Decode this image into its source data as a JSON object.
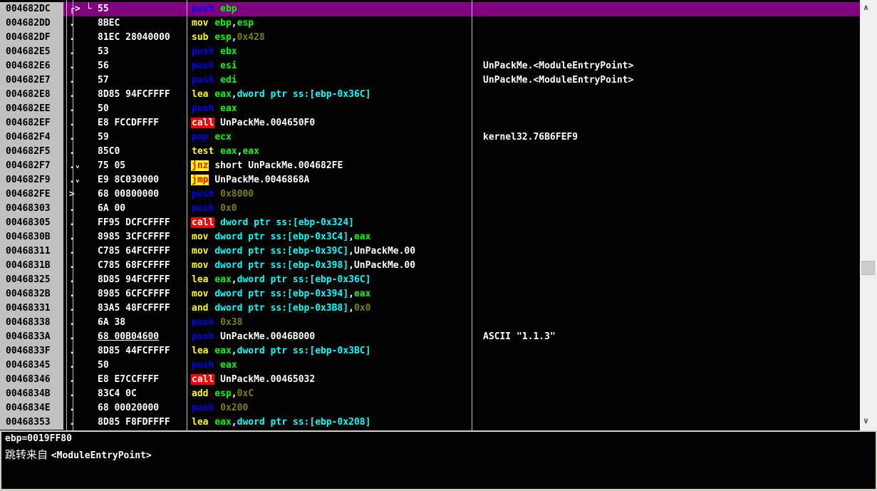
{
  "disasm": {
    "rows": [
      {
        "addr": "004682DC",
        "arrow": "┌> └",
        "bytes": "55",
        "mn": "push",
        "ops": [
          [
            "ebp",
            "reg"
          ]
        ],
        "cmt": "",
        "sel": true
      },
      {
        "addr": "004682DD",
        "arrow": ".",
        "bytes": "8BEC",
        "mn": "mov",
        "ops": [
          [
            "ebp",
            "reg"
          ],
          [
            ",",
            "lbl"
          ],
          [
            "esp",
            "reg"
          ]
        ],
        "cmt": ""
      },
      {
        "addr": "004682DF",
        "arrow": ".",
        "bytes": "81EC 28040000",
        "mn": "sub",
        "ops": [
          [
            "esp",
            "reg"
          ],
          [
            ",",
            "lbl"
          ],
          [
            "0x428",
            "imm"
          ]
        ],
        "cmt": ""
      },
      {
        "addr": "004682E5",
        "arrow": ".",
        "bytes": "53",
        "mn": "push",
        "ops": [
          [
            "ebx",
            "reg"
          ]
        ],
        "cmt": ""
      },
      {
        "addr": "004682E6",
        "arrow": ".",
        "bytes": "56",
        "mn": "push",
        "ops": [
          [
            "esi",
            "reg"
          ]
        ],
        "cmt": "UnPackMe.<ModuleEntryPoint>"
      },
      {
        "addr": "004682E7",
        "arrow": ".",
        "bytes": "57",
        "mn": "push",
        "ops": [
          [
            "edi",
            "reg"
          ]
        ],
        "cmt": "UnPackMe.<ModuleEntryPoint>"
      },
      {
        "addr": "004682E8",
        "arrow": ".",
        "bytes": "8D85 94FCFFFF",
        "mn": "lea",
        "ops": [
          [
            "eax",
            "reg"
          ],
          [
            ",",
            "lbl"
          ],
          [
            "dword ptr ss:[ebp-0x36C]",
            "mem"
          ]
        ],
        "cmt": ""
      },
      {
        "addr": "004682EE",
        "arrow": ".",
        "bytes": "50",
        "mn": "push",
        "ops": [
          [
            "eax",
            "reg"
          ]
        ],
        "cmt": ""
      },
      {
        "addr": "004682EF",
        "arrow": ".",
        "bytes": "E8 FCCDFFFF",
        "mn": "call",
        "ops": [
          [
            "UnPackMe.004650F0",
            "lbl"
          ]
        ],
        "cmt": ""
      },
      {
        "addr": "004682F4",
        "arrow": ".",
        "bytes": "59",
        "mn": "pop",
        "ops": [
          [
            "ecx",
            "reg"
          ]
        ],
        "cmt": "kernel32.76B6FEF9"
      },
      {
        "addr": "004682F5",
        "arrow": ".",
        "bytes": "85C0",
        "mn": "test",
        "ops": [
          [
            "eax",
            "reg"
          ],
          [
            ",",
            "lbl"
          ],
          [
            "eax",
            "reg"
          ]
        ],
        "cmt": ""
      },
      {
        "addr": "004682F7",
        "arrow": ".ᵥ",
        "bytes": "75 05",
        "mn": "jnz",
        "ops": [
          [
            "short UnPackMe.004682FE",
            "lbl"
          ]
        ],
        "cmt": ""
      },
      {
        "addr": "004682F9",
        "arrow": ".ᵥ",
        "bytes": "E9 8C030000",
        "mn": "jmp",
        "ops": [
          [
            "UnPackMe.0046868A",
            "lbl"
          ]
        ],
        "cmt": ""
      },
      {
        "addr": "004682FE",
        "arrow": ">",
        "bytes": "68 00800000",
        "mn": "push",
        "ops": [
          [
            "0x8000",
            "imm"
          ]
        ],
        "cmt": ""
      },
      {
        "addr": "00468303",
        "arrow": ".",
        "bytes": "6A 00",
        "mn": "push",
        "ops": [
          [
            "0x0",
            "imm"
          ]
        ],
        "cmt": ""
      },
      {
        "addr": "00468305",
        "arrow": ".",
        "bytes": "FF95 DCFCFFFF",
        "mn": "call",
        "ops": [
          [
            "dword ptr ss:[ebp-0x324]",
            "mem"
          ]
        ],
        "cmt": ""
      },
      {
        "addr": "0046830B",
        "arrow": ".",
        "bytes": "8985 3CFCFFFF",
        "mn": "mov",
        "ops": [
          [
            "dword ptr ss:[ebp-0x3C4]",
            "mem"
          ],
          [
            ",",
            "lbl"
          ],
          [
            "eax",
            "reg"
          ]
        ],
        "cmt": ""
      },
      {
        "addr": "00468311",
        "arrow": ".",
        "bytes": "C785 64FCFFFF",
        "mn": "mov",
        "ops": [
          [
            "dword ptr ss:[ebp-0x39C]",
            "mem"
          ],
          [
            ",UnPackMe.00",
            "lbl"
          ]
        ],
        "cmt": ""
      },
      {
        "addr": "0046831B",
        "arrow": ".",
        "bytes": "C785 68FCFFFF",
        "mn": "mov",
        "ops": [
          [
            "dword ptr ss:[ebp-0x398]",
            "mem"
          ],
          [
            ",UnPackMe.00",
            "lbl"
          ]
        ],
        "cmt": ""
      },
      {
        "addr": "00468325",
        "arrow": ".",
        "bytes": "8D85 94FCFFFF",
        "mn": "lea",
        "ops": [
          [
            "eax",
            "reg"
          ],
          [
            ",",
            "lbl"
          ],
          [
            "dword ptr ss:[ebp-0x36C]",
            "mem"
          ]
        ],
        "cmt": ""
      },
      {
        "addr": "0046832B",
        "arrow": ".",
        "bytes": "8985 6CFCFFFF",
        "mn": "mov",
        "ops": [
          [
            "dword ptr ss:[ebp-0x394]",
            "mem"
          ],
          [
            ",",
            "lbl"
          ],
          [
            "eax",
            "reg"
          ]
        ],
        "cmt": ""
      },
      {
        "addr": "00468331",
        "arrow": ".",
        "bytes": "83A5 48FCFFFF",
        "mn": "and",
        "ops": [
          [
            "dword ptr ss:[ebp-0x3B8]",
            "mem"
          ],
          [
            ",",
            "lbl"
          ],
          [
            "0x0",
            "imm"
          ]
        ],
        "cmt": ""
      },
      {
        "addr": "00468338",
        "arrow": ".",
        "bytes": "6A 38",
        "mn": "push",
        "ops": [
          [
            "0x38",
            "imm"
          ]
        ],
        "cmt": ""
      },
      {
        "addr": "0046833A",
        "arrow": ".",
        "bytes": "68 00B04600",
        "mn": "push",
        "ops": [
          [
            "UnPackMe.0046B000",
            "lbl"
          ]
        ],
        "cmt": "ASCII \"1.1.3\"",
        "ul": true
      },
      {
        "addr": "0046833F",
        "arrow": ".",
        "bytes": "8D85 44FCFFFF",
        "mn": "lea",
        "ops": [
          [
            "eax",
            "reg"
          ],
          [
            ",",
            "lbl"
          ],
          [
            "dword ptr ss:[ebp-0x3BC]",
            "mem"
          ]
        ],
        "cmt": ""
      },
      {
        "addr": "00468345",
        "arrow": ".",
        "bytes": "50",
        "mn": "push",
        "ops": [
          [
            "eax",
            "reg"
          ]
        ],
        "cmt": ""
      },
      {
        "addr": "00468346",
        "arrow": ".",
        "bytes": "E8 E7CCFFFF",
        "mn": "call",
        "ops": [
          [
            "UnPackMe.00465032",
            "lbl"
          ]
        ],
        "cmt": ""
      },
      {
        "addr": "0046834B",
        "arrow": ".",
        "bytes": "83C4 0C",
        "mn": "add",
        "ops": [
          [
            "esp",
            "reg"
          ],
          [
            ",",
            "lbl"
          ],
          [
            "0xC",
            "imm"
          ]
        ],
        "cmt": ""
      },
      {
        "addr": "0046834E",
        "arrow": ".",
        "bytes": "68 00020000",
        "mn": "push",
        "ops": [
          [
            "0x200",
            "imm"
          ]
        ],
        "cmt": ""
      },
      {
        "addr": "00468353",
        "arrow": ".",
        "bytes": "8D85 F8FDFFFF",
        "mn": "lea",
        "ops": [
          [
            "eax",
            "reg"
          ],
          [
            ",",
            "lbl"
          ],
          [
            "dword ptr ss:[ebp-0x208]",
            "mem"
          ]
        ],
        "cmt": ""
      }
    ]
  },
  "info": {
    "line1": "ebp=0019FF80",
    "line2_prefix": "跳转来自",
    "line2_target": "<ModuleEntryPoint>"
  },
  "scrollbar": {
    "up_icon": "chevron-up-icon",
    "down_icon": "chevron-down-icon",
    "up_glyph": "∧",
    "down_glyph": "∨"
  },
  "colors": {
    "selection": "#800080",
    "address_bg": "#c0c0c0",
    "push_pop": "#0000ff",
    "mov_like": "#ffff00",
    "call_bg": "#ff0000",
    "jump_bg": "#ffff00",
    "register": "#00ff00",
    "memory": "#00ffff",
    "immediate": "#808000"
  }
}
